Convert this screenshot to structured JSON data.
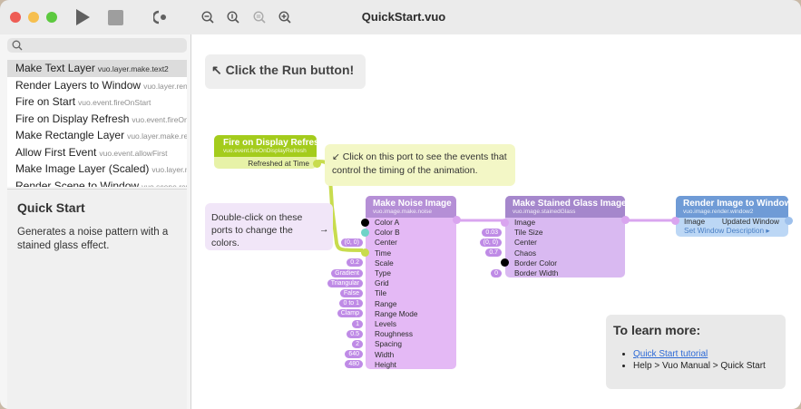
{
  "window": {
    "title": "QuickStart.vuo"
  },
  "colors": {
    "close": "#ee5d55",
    "minimize": "#f6bf4f",
    "zoom": "#5cc93f",
    "trigger_green": "#a4cc1c",
    "noise_purple": "#b58fd6",
    "glass_purple": "#a587cc",
    "render_blue": "#6f9bd6",
    "port_pill": "#bf8be6"
  },
  "toolbar": {
    "icons": [
      "run-icon",
      "stop-icon",
      "input-editor-icon",
      "zoom-out-icon",
      "actual-size-icon",
      "zoom-to-fit-icon",
      "zoom-in-icon"
    ]
  },
  "sidebar": {
    "search_icon": "magnifier-icon",
    "nodes": [
      {
        "name": "Make Text Layer",
        "class": "vuo.layer.make.text2"
      },
      {
        "name": "Render Layers to Window",
        "class": "vuo.layer.render.w"
      },
      {
        "name": "Fire on Start",
        "class": "vuo.event.fireOnStart"
      },
      {
        "name": "Fire on Display Refresh",
        "class": "vuo.event.fireOnDisp"
      },
      {
        "name": "Make Rectangle Layer",
        "class": "vuo.layer.make.rect"
      },
      {
        "name": "Allow First Event",
        "class": "vuo.event.allowFirst"
      },
      {
        "name": "Make Image Layer (Scaled)",
        "class": "vuo.layer.make.:"
      },
      {
        "name": "Render Scene to Window",
        "class": "vuo.scene.render.v"
      }
    ],
    "doc_title": "Quick Start",
    "doc_text": "Generates a noise pattern with a stained glass effect."
  },
  "canvas": {
    "run_comment": "↖ Click the Run button!",
    "events_comment": "↙ Click on this port to see the events that control the timing of the animation.",
    "colors_comment": "Double-click on these ports to change the colors.",
    "colors_arrow": "→",
    "fire_node": {
      "title": "Fire on Display Refresh",
      "class": "vuo.event.fireOnDisplayRefresh",
      "output": "Refreshed at Time"
    },
    "noise_node": {
      "title": "Make Noise Image",
      "class": "vuo.image.make.noise",
      "ports": [
        {
          "label": "Color A",
          "value": ""
        },
        {
          "label": "Color B",
          "value": ""
        },
        {
          "label": "Center",
          "value": "(0, 0)"
        },
        {
          "label": "Time",
          "value": ""
        },
        {
          "label": "Scale",
          "value": "0.2"
        },
        {
          "label": "Type",
          "value": "Gradient"
        },
        {
          "label": "Grid",
          "value": "Triangular"
        },
        {
          "label": "Tile",
          "value": "False"
        },
        {
          "label": "Range",
          "value": "0 to 1"
        },
        {
          "label": "Range Mode",
          "value": "Clamp"
        },
        {
          "label": "Levels",
          "value": "1"
        },
        {
          "label": "Roughness",
          "value": "0.5"
        },
        {
          "label": "Spacing",
          "value": "2"
        },
        {
          "label": "Width",
          "value": "640"
        },
        {
          "label": "Height",
          "value": "480"
        }
      ]
    },
    "glass_node": {
      "title": "Make Stained Glass Image",
      "class": "vuo.image.stainedGlass",
      "ports": [
        {
          "label": "Image",
          "value": ""
        },
        {
          "label": "Tile Size",
          "value": "0.03"
        },
        {
          "label": "Center",
          "value": "(0, 0)"
        },
        {
          "label": "Chaos",
          "value": "0.7"
        },
        {
          "label": "Border Color",
          "value": ""
        },
        {
          "label": "Border Width",
          "value": "0"
        }
      ]
    },
    "render_node": {
      "title": "Render Image to Window",
      "class": "vuo.image.render.window2",
      "in1": "Image",
      "out1": "Updated Window",
      "in2": "Set Window Description ▸"
    },
    "learn_title": "To learn more:",
    "learn_link": "Quick Start tutorial",
    "learn_path": "Help > Vuo Manual > Quick Start"
  }
}
